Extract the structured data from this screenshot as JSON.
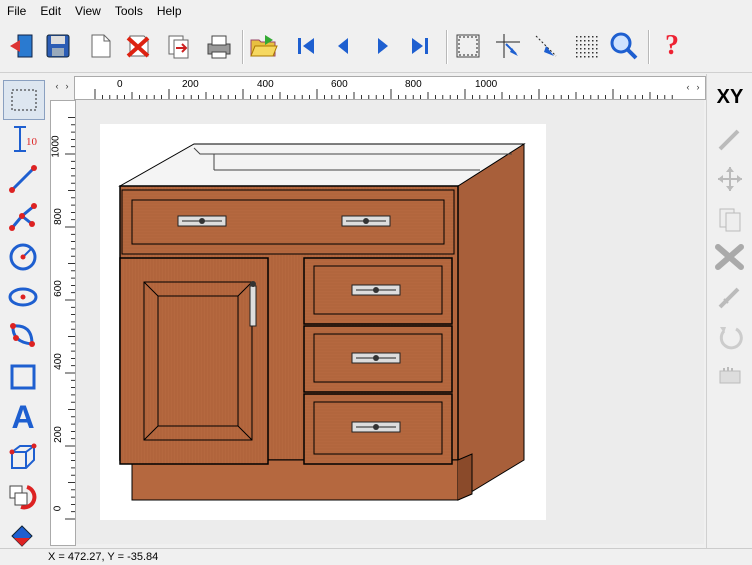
{
  "menu": {
    "items": [
      "File",
      "Edit",
      "View",
      "Tools",
      "Help"
    ]
  },
  "toolbar": {
    "buttons": [
      "exit-icon",
      "save-icon",
      "new-icon",
      "delete-icon",
      "export-icon",
      "print-icon",
      "open-folder-icon",
      "first-icon",
      "prev-icon",
      "next-icon",
      "last-icon",
      "frame-select-icon",
      "cut-line-icon",
      "arrow-select-icon",
      "grid-icon",
      "zoom-icon",
      "help-icon"
    ],
    "help_label": "?"
  },
  "left_tools": [
    "select-rect-icon",
    "dimension-icon",
    "line-icon",
    "polyline-icon",
    "circle-icon",
    "ellipse-icon",
    "arc-icon",
    "rectangle-icon",
    "text-icon",
    "box3d-icon",
    "rotate-copy-icon",
    "fill-icon"
  ],
  "dimension_label": "10",
  "text_tool_label": "A",
  "right_tools": {
    "xy_label": "XY",
    "buttons": [
      "pencil-icon",
      "move-icon",
      "copy-icon",
      "scissors-icon",
      "knife-icon",
      "rotate-icon",
      "hand-icon"
    ]
  },
  "hruler": {
    "ticks": [
      "0",
      "200",
      "400",
      "600",
      "800",
      "1000"
    ]
  },
  "vruler": {
    "ticks": [
      "1000",
      "800",
      "600",
      "400",
      "200",
      "0"
    ]
  },
  "status": {
    "coords": "X = 472.27, Y = -35.84"
  },
  "colors": {
    "wood": "#b5683f",
    "wood_dark": "#8a4a2a",
    "toolbar_blue": "#1e5fd0"
  }
}
